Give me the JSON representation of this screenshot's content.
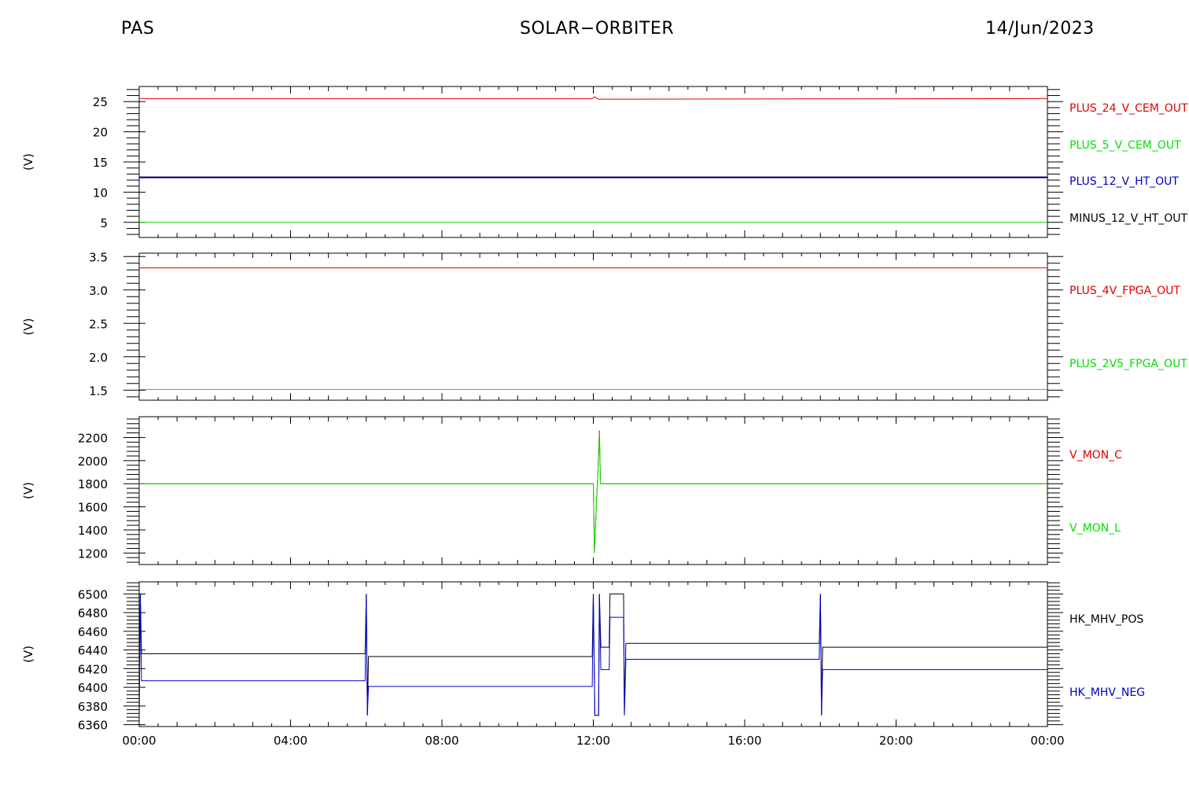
{
  "header": {
    "left": "PAS",
    "center": "SOLAR−ORBITER",
    "right": "14/Jun/2023"
  },
  "colors": {
    "red": "#e00000",
    "green": "#00e000",
    "blue": "#0000c8",
    "black": "#000000"
  },
  "chart_data": [
    {
      "type": "line",
      "ylabel": "(V)",
      "ylim": [
        2.5,
        27.5
      ],
      "yticks": [
        5,
        10,
        15,
        20,
        25
      ],
      "ytick_labels": [
        "5",
        "10",
        "15",
        "20",
        "25"
      ],
      "xlim_hours": [
        0,
        24
      ],
      "x": [
        "00:00",
        "12:00",
        "12:05",
        "12:15",
        "24:00"
      ],
      "series": [
        {
          "name": "PLUS_24_V_CEM_OUT",
          "color": "#e00000",
          "points": [
            [
              0,
              25.5
            ],
            [
              11.98,
              25.5
            ],
            [
              12.03,
              25.8
            ],
            [
              12.13,
              25.4
            ],
            [
              24,
              25.5
            ]
          ]
        },
        {
          "name": "PLUS_5_V_CEM_OUT",
          "color": "#00e000",
          "points": [
            [
              0,
              5.0
            ],
            [
              24,
              5.0
            ]
          ]
        },
        {
          "name": "PLUS_12_V_HT_OUT",
          "color": "#0000c8",
          "points": [
            [
              0,
              12.45
            ],
            [
              24,
              12.45
            ]
          ]
        },
        {
          "name": "MINUS_12_V_HT_OUT",
          "color": "#000000",
          "points": [
            [
              0,
              12.5
            ],
            [
              24,
              12.5
            ]
          ]
        }
      ]
    },
    {
      "type": "line",
      "ylabel": "(V)",
      "ylim": [
        1.35,
        3.55
      ],
      "yticks": [
        1.5,
        2.0,
        2.5,
        3.0,
        3.5
      ],
      "ytick_labels": [
        "1.5",
        "2.0",
        "2.5",
        "3.0",
        "3.5"
      ],
      "xlim_hours": [
        0,
        24
      ],
      "series": [
        {
          "name": "PLUS_4V_FPGA_OUT",
          "color": "#e00000",
          "points": [
            [
              0,
              3.33
            ],
            [
              24,
              3.33
            ]
          ]
        },
        {
          "name": "PLUS_2V5_FPGA_OUT",
          "color": "#00e000",
          "points": [
            [
              0,
              1.51
            ],
            [
              24,
              1.51
            ]
          ]
        }
      ]
    },
    {
      "type": "line",
      "ylabel": "(V)",
      "ylim": [
        1100,
        2380
      ],
      "yticks": [
        1200,
        1400,
        1600,
        1800,
        2000,
        2200
      ],
      "ytick_labels": [
        "1200",
        "1400",
        "1600",
        "1800",
        "2000",
        "2200"
      ],
      "xlim_hours": [
        0,
        24
      ],
      "series": [
        {
          "name": "V_MON_C",
          "color": "#e00000",
          "points": [
            [
              0,
              1800
            ],
            [
              12.0,
              1800
            ],
            [
              12.03,
              1200
            ],
            [
              12.08,
              1600
            ],
            [
              12.12,
              1900
            ],
            [
              12.16,
              2260
            ],
            [
              12.19,
              1800
            ],
            [
              24,
              1800
            ]
          ]
        },
        {
          "name": "V_MON_L",
          "color": "#00e000",
          "points": [
            [
              0,
              1800
            ],
            [
              12.0,
              1800
            ],
            [
              12.03,
              1200
            ],
            [
              12.08,
              1600
            ],
            [
              12.12,
              1900
            ],
            [
              12.16,
              2240
            ],
            [
              12.19,
              1800
            ],
            [
              24,
              1800
            ]
          ]
        }
      ]
    },
    {
      "type": "line",
      "ylabel": "(V)",
      "ylim": [
        6358,
        6513
      ],
      "yticks": [
        6360,
        6380,
        6400,
        6420,
        6440,
        6460,
        6480,
        6500
      ],
      "ytick_labels": [
        "6360",
        "6380",
        "6400",
        "6420",
        "6440",
        "6460",
        "6480",
        "6500"
      ],
      "xlim_hours": [
        0,
        24
      ],
      "xtick_labels": [
        "00:00",
        "04:00",
        "08:00",
        "12:00",
        "16:00",
        "20:00",
        "00:00"
      ],
      "xticks_hours": [
        0,
        4,
        8,
        12,
        16,
        20,
        24
      ],
      "series": [
        {
          "name": "HK_MHV_POS",
          "color": "#000000",
          "points": [
            [
              0,
              6370
            ],
            [
              0.03,
              6500
            ],
            [
              0.06,
              6436
            ],
            [
              5.97,
              6436
            ],
            [
              6.0,
              6500
            ],
            [
              6.03,
              6370
            ],
            [
              6.06,
              6433
            ],
            [
              11.97,
              6433
            ],
            [
              12.0,
              6500
            ],
            [
              12.04,
              6370
            ],
            [
              12.14,
              6370
            ],
            [
              12.16,
              6500
            ],
            [
              12.2,
              6443
            ],
            [
              12.42,
              6443
            ],
            [
              12.44,
              6500
            ],
            [
              12.8,
              6500
            ],
            [
              12.82,
              6370
            ],
            [
              12.86,
              6447
            ],
            [
              17.97,
              6447
            ],
            [
              18.0,
              6500
            ],
            [
              18.03,
              6370
            ],
            [
              18.06,
              6443
            ],
            [
              24,
              6443
            ]
          ]
        },
        {
          "name": "HK_MHV_NEG",
          "color": "#0000c8",
          "points": [
            [
              0,
              6370
            ],
            [
              0.03,
              6500
            ],
            [
              0.06,
              6407
            ],
            [
              5.97,
              6407
            ],
            [
              6.0,
              6500
            ],
            [
              6.03,
              6370
            ],
            [
              6.06,
              6401
            ],
            [
              11.97,
              6401
            ],
            [
              12.0,
              6500
            ],
            [
              12.04,
              6370
            ],
            [
              12.14,
              6370
            ],
            [
              12.16,
              6500
            ],
            [
              12.2,
              6419
            ],
            [
              12.42,
              6419
            ],
            [
              12.44,
              6475
            ],
            [
              12.8,
              6475
            ],
            [
              12.82,
              6370
            ],
            [
              12.86,
              6430
            ],
            [
              17.97,
              6430
            ],
            [
              18.0,
              6500
            ],
            [
              18.03,
              6370
            ],
            [
              18.06,
              6419
            ],
            [
              24,
              6419
            ]
          ]
        }
      ]
    }
  ]
}
